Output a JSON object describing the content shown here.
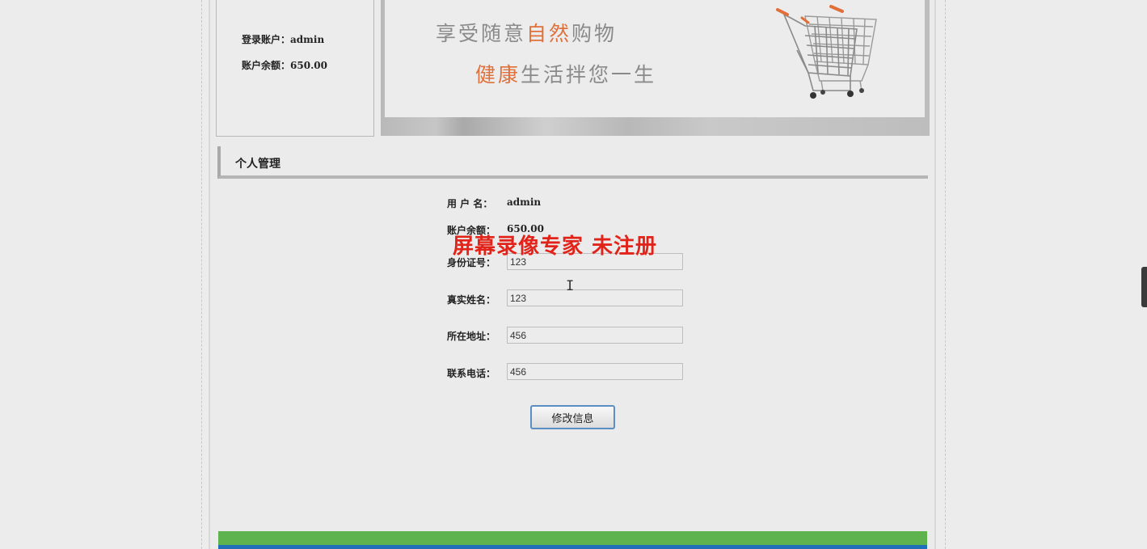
{
  "sidebar": {
    "login_label": "登录账户：",
    "login_value": "admin",
    "balance_label": "账户余额：",
    "balance_value": "650.00"
  },
  "banner": {
    "line1_pre": "享受随意",
    "line1_accent": "自然",
    "line1_post": "购物",
    "line2_accent": "健康",
    "line2_post": "生活拌您一生",
    "accent_color": "#e0703a",
    "icon": "shopping-cart-icon"
  },
  "section": {
    "title": "个人管理"
  },
  "form": {
    "username_label": "用 户 名：",
    "username_value": "admin",
    "balance_label": "账户余额：",
    "balance_value": "650.00",
    "idcard_label": "身份证号：",
    "idcard_value": "123",
    "realname_label": "真实姓名：",
    "realname_value": "123",
    "address_label": "所在地址：",
    "address_value": "456",
    "phone_label": "联系电话：",
    "phone_value": "456",
    "submit_label": "修改信息"
  },
  "watermark": {
    "text": "屏幕录像专家  未注册",
    "color": "#e2231a"
  },
  "footer": {
    "green": "#5fb34e",
    "blue": "#1f6fb8"
  }
}
